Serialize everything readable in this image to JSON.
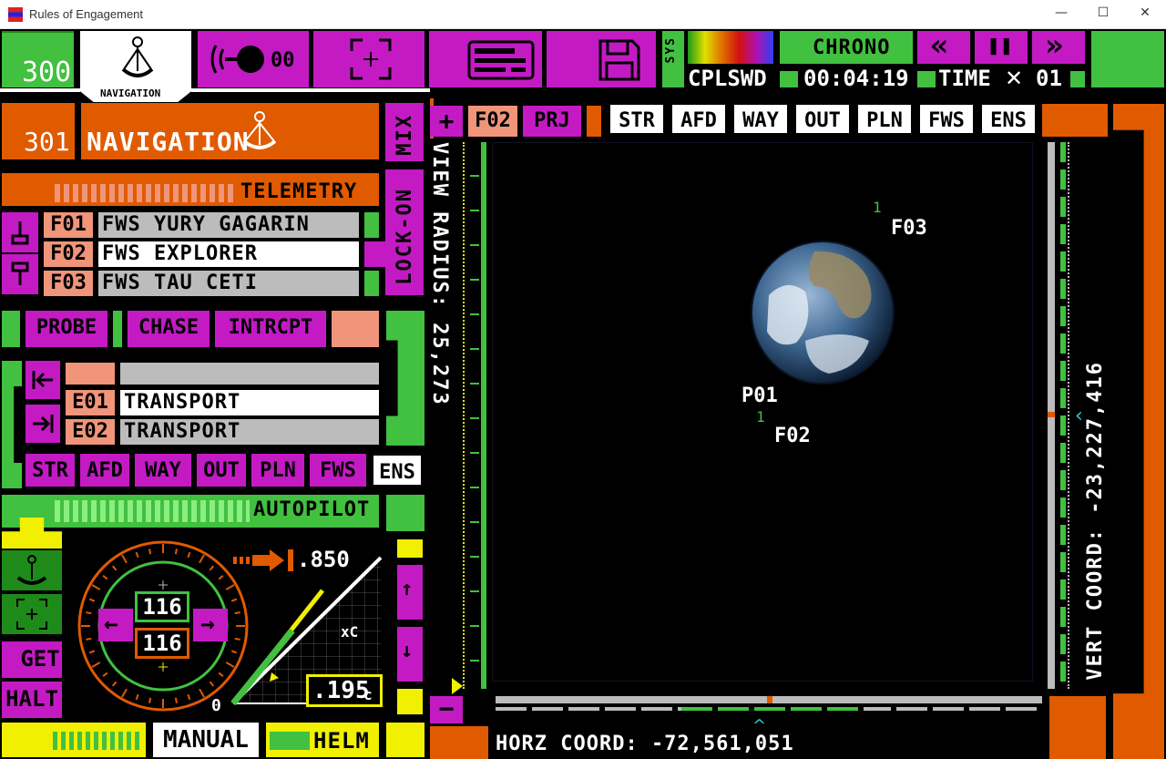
{
  "window": {
    "title": "Rules of Engagement",
    "minimize": "—",
    "maximize": "☐",
    "close": "✕"
  },
  "header": {
    "station_num": "300",
    "nav_tab_label": "NAVIGATION",
    "comms_count": "00",
    "sys_label": "SYS",
    "chrono_label": "CHRONO",
    "rewind": "«",
    "pause": "❚❚",
    "ffwd": "»",
    "mode": "CPLSWD",
    "clock": "00:04:19",
    "time_label": "TIME",
    "time_mult_sym": "✕",
    "time_mult": "01"
  },
  "panel": {
    "num": "301",
    "title": "NAVIGATION",
    "mix": "MIX",
    "lockon": "LOCK-ON",
    "telemetry": "TELEMETRY",
    "ships": [
      {
        "code": "F01",
        "name": "FWS YURY GAGARIN"
      },
      {
        "code": "F02",
        "name": "FWS EXPLORER"
      },
      {
        "code": "F03",
        "name": "FWS TAU CETI"
      }
    ],
    "actions": [
      "PROBE",
      "CHASE",
      "INTRCPT"
    ],
    "enemies": [
      {
        "code": "E01",
        "name": "TRANSPORT"
      },
      {
        "code": "E02",
        "name": "TRANSPORT"
      }
    ],
    "filters": [
      "STR",
      "AFD",
      "WAY",
      "OUT",
      "PLN",
      "FWS",
      "ENS"
    ],
    "autopilot": "AUTOPILOT",
    "get": "GET",
    "halt": "HALT",
    "manual": "MANUAL",
    "helm": "HELM"
  },
  "helm": {
    "heading_a": "116",
    "heading_b": "116",
    "throttle": ".850",
    "speed": ".195",
    "speed_unit": "c",
    "axis_label": "xC",
    "zero": "0"
  },
  "viewer": {
    "plus": "+",
    "minus": "−",
    "focus": "F02",
    "proj": "PRJ",
    "filters": [
      "STR",
      "AFD",
      "WAY",
      "OUT",
      "PLN",
      "FWS",
      "ENS"
    ],
    "view_radius": "VIEW RADIUS: 25,273",
    "horz_coord": "HORZ COORD: -72,561,051",
    "vert_coord": "VERT COORD: -23,227,416",
    "markers": [
      {
        "label": "F03",
        "count": "1"
      },
      {
        "label": "P01",
        "count": ""
      },
      {
        "label": "F02",
        "count": "1"
      }
    ]
  }
}
